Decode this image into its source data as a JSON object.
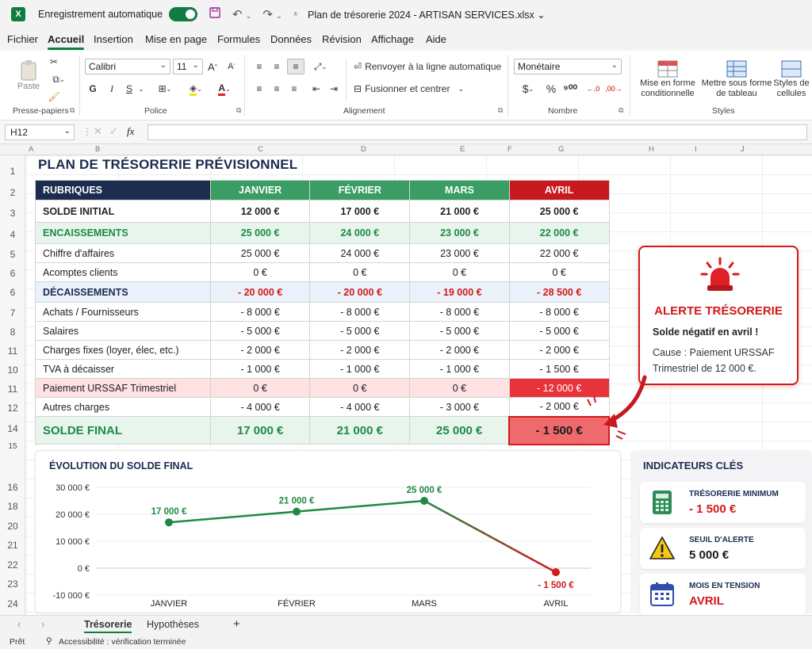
{
  "titlebar": {
    "autosave_label": "Enregistrement automatique",
    "doc_title": "Plan de trésorerie 2024 - ARTISAN SERVICES.xlsx ⌄"
  },
  "menu": [
    "Fichier",
    "Accueil",
    "Insertion",
    "Mise en page",
    "Formules",
    "Données",
    "Révision",
    "Affichage",
    "Aide"
  ],
  "ribbon": {
    "paste": "Paste",
    "clipboard_label": "Presse-papiers",
    "font_name": "Calibri",
    "font_size": "11",
    "font_label": "Police",
    "wrap_text": "Renvoyer à la ligne automatique",
    "merge_center": "Fusionner et centrer",
    "alignment_label": "Alignement",
    "number_format": "Monétaire",
    "number_label": "Nombre",
    "cond_format": "Mise en forme conditionnelle",
    "format_table": "Mettre sous forme de tableau",
    "cell_styles": "Styles de cellules",
    "styles_label": "Styles"
  },
  "formula_bar": {
    "name_box": "H12",
    "fx": "fx"
  },
  "columns": [
    "A",
    "B",
    "C",
    "D",
    "E",
    "F",
    "G",
    "H",
    "I",
    "J"
  ],
  "rows": [
    "1",
    "2",
    "3",
    "4",
    "5",
    "6",
    "6",
    "7",
    "8",
    "11",
    "10",
    "11",
    "12",
    "14",
    "15",
    "16",
    "18",
    "20",
    "21",
    "22",
    "23",
    "24"
  ],
  "sheet_title": "PLAN DE TRÉSORERIE PRÉVISIONNEL",
  "table": {
    "header": [
      "RUBRIQUES",
      "JANVIER",
      "FÉVRIER",
      "MARS",
      "AVRIL"
    ],
    "rows": [
      {
        "label": "SOLDE INITIAL",
        "values": [
          "12 000 €",
          "17 000 €",
          "21 000 €",
          "25 000 €"
        ]
      },
      {
        "label": "ENCAISSEMENTS",
        "values": [
          "25 000 €",
          "24 000 €",
          "23 000 €",
          "22 000 €"
        ]
      },
      {
        "label": "Chiffre d'affaires",
        "values": [
          "25 000 €",
          "24 000 €",
          "23 000 €",
          "22 000 €"
        ]
      },
      {
        "label": "Acomptes clients",
        "values": [
          "0 €",
          "0 €",
          "0 €",
          "0 €"
        ]
      },
      {
        "label": "DÉCAISSEMENTS",
        "values": [
          "- 20 000 €",
          "- 20 000 €",
          "- 19 000 €",
          "- 28 500 €"
        ]
      },
      {
        "label": "Achats / Fournisseurs",
        "values": [
          "- 8 000 €",
          "- 8 000 €",
          "- 8 000 €",
          "- 8 000 €"
        ]
      },
      {
        "label": "Salaires",
        "values": [
          "- 5 000 €",
          "- 5 000 €",
          "- 5 000 €",
          "- 5 000 €"
        ]
      },
      {
        "label": "Charges fixes (loyer, élec, etc.)",
        "values": [
          "- 2 000 €",
          "- 2 000 €",
          "- 2 000 €",
          "- 2 000 €"
        ]
      },
      {
        "label": "TVA à décaisser",
        "values": [
          "- 1 000 €",
          "- 1 000 €",
          "- 1 000 €",
          "- 1 500 €"
        ]
      },
      {
        "label": "Paiement URSSAF Trimestriel",
        "values": [
          "0 €",
          "0 €",
          "0 €",
          "- 12 000 €"
        ]
      },
      {
        "label": "Autres charges",
        "values": [
          "- 4 000 €",
          "- 4 000 €",
          "- 3 000 €",
          "- 2 000 €"
        ]
      },
      {
        "label": "SOLDE FINAL",
        "values": [
          "17 000 €",
          "21 000 €",
          "25 000 €",
          "- 1 500 €"
        ]
      }
    ]
  },
  "alert": {
    "title": "ALERTE TRÉSORERIE",
    "line1": "Solde négatif en avril !",
    "line2": "Cause : Paiement URSSAF Trimestriel de 12 000 €."
  },
  "chart_data": {
    "type": "line",
    "title": "ÉVOLUTION DU SOLDE FINAL",
    "categories": [
      "JANVIER",
      "FÉVRIER",
      "MARS",
      "AVRIL"
    ],
    "values": [
      17000,
      21000,
      25000,
      -1500
    ],
    "data_labels": [
      "17 000 €",
      "21 000 €",
      "25 000 €",
      "- 1 500 €"
    ],
    "yticks": [
      "30 000 €",
      "20 000 €",
      "10 000 €",
      "0 €",
      "-10 000 €"
    ],
    "ytick_values": [
      30000,
      20000,
      10000,
      0,
      -10000
    ],
    "ylim": [
      -10000,
      30000
    ],
    "colors": {
      "positive": "#1e8a44",
      "negative": "#d21a1a"
    }
  },
  "kpi": {
    "title": "INDICATEURS CLÉS",
    "cards": [
      {
        "label": "TRÉSORERIE MINIMUM",
        "value": "- 1 500 €",
        "icon": "calculator-icon",
        "color": "#d21a1a"
      },
      {
        "label": "SEUIL D'ALERTE",
        "value": "5 000 €",
        "icon": "warning-icon",
        "color": "#1a1a1a"
      },
      {
        "label": "MOIS EN TENSION",
        "value": "AVRIL",
        "icon": "calendar-icon",
        "color": "#d21a1a"
      }
    ]
  },
  "sheet_tabs": [
    "Trésorerie",
    "Hypothèses"
  ],
  "status": {
    "ready": "Prêt",
    "accessibility": "Accessibilité : vérification terminée"
  }
}
